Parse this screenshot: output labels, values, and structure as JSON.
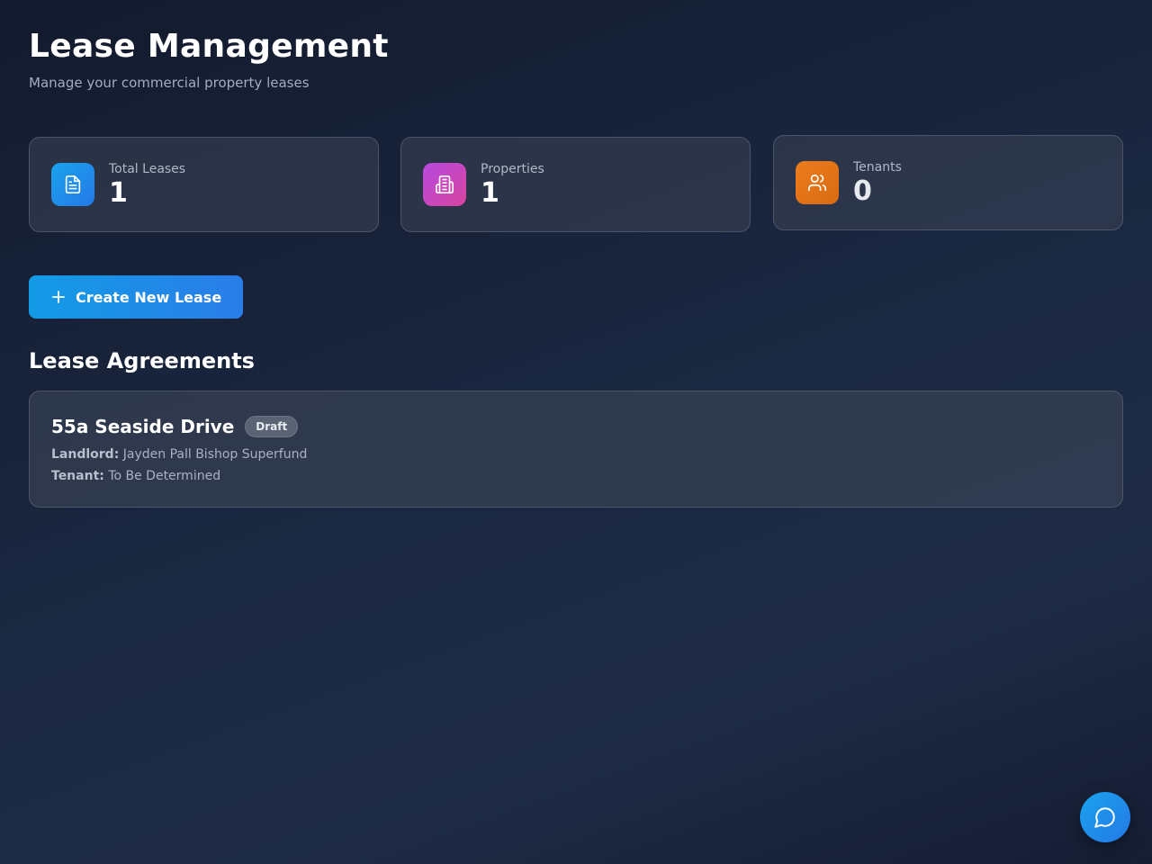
{
  "header": {
    "title": "Lease Management",
    "subtitle": "Manage your commercial property leases"
  },
  "stats": [
    {
      "label": "Total Leases",
      "value": "1",
      "icon": "document-icon",
      "color": "#1f8de9"
    },
    {
      "label": "Properties",
      "value": "1",
      "icon": "building-icon",
      "color": "#c948c2"
    },
    {
      "label": "Tenants",
      "value": "0",
      "icon": "users-icon",
      "color": "#e57618"
    }
  ],
  "actions": {
    "create_label": "Create New Lease"
  },
  "leases_section": {
    "title": "Lease Agreements",
    "items": [
      {
        "title": "55a Seaside Drive",
        "status": "Draft",
        "landlord_label": "Landlord:",
        "landlord": "Jayden Pall Bishop Superfund",
        "tenant_label": "Tenant:",
        "tenant": "To Be Determined"
      }
    ]
  },
  "chat": {
    "icon": "chat-bubble-icon"
  }
}
